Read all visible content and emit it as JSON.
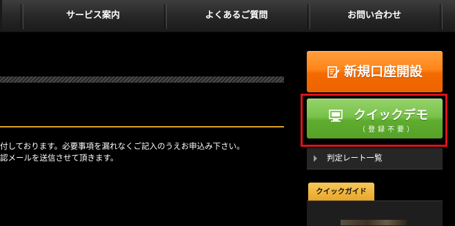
{
  "nav": {
    "items": [
      "サービス案内",
      "よくあるご質問",
      "お問い合わせ"
    ]
  },
  "main": {
    "lines": [
      "付しております。必要事項を漏れなくご記入のうえお申込み下さい。",
      "認メールを送信させて頂きます。"
    ]
  },
  "sidebar": {
    "new_account_label": "新規口座開設",
    "quick_demo_label": "クイックデモ",
    "quick_demo_sub": "（登録不要）",
    "rate_link_label": "判定レート一覧",
    "quick_guide_label": "クイックガイド"
  },
  "icons": {
    "new_account": "memo-pencil-icon",
    "quick_demo": "monitor-icon",
    "rate_link": "triangle-right-icon"
  },
  "colors": {
    "accent_orange": "#f57a10",
    "accent_green": "#6cb83e",
    "highlight_red": "#e0121a",
    "rule_gold": "#e3a524"
  }
}
